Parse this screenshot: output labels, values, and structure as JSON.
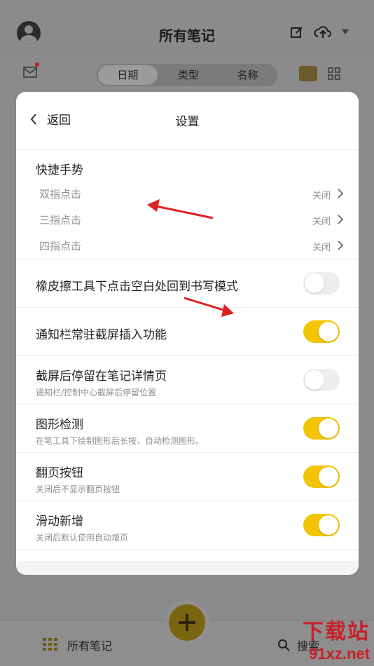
{
  "background": {
    "title": "所有笔记",
    "segments": [
      "日期",
      "类型",
      "名称"
    ],
    "bottom_label": "所有笔记",
    "bottom_search": "搜索"
  },
  "modal": {
    "back_label": "返回",
    "title": "设置",
    "gesture_group": {
      "title": "快捷手势",
      "items": [
        {
          "label": "双指点击",
          "value": "关闭"
        },
        {
          "label": "三指点击",
          "value": "关闭"
        },
        {
          "label": "四指点击",
          "value": "关闭"
        }
      ]
    },
    "settings": [
      {
        "title": "橡皮擦工具下点击空白处回到书写模式",
        "desc": "",
        "on": false
      },
      {
        "title": "通知栏常驻截屏插入功能",
        "desc": "",
        "on": true
      },
      {
        "title": "截屏后停留在笔记详情页",
        "desc": "通知栏/控制中心截屏后停留位置",
        "on": false
      },
      {
        "title": "图形检测",
        "desc": "在笔工具下绘制图形后长按，自动检测图形。",
        "on": true
      },
      {
        "title": "翻页按钮",
        "desc": "关闭后不显示翻页按钮",
        "on": true
      },
      {
        "title": "滑动新增",
        "desc": "关闭后默认使用自动增页",
        "on": true
      }
    ]
  },
  "watermark": {
    "line1": "下载站",
    "line2": "91xz.net"
  },
  "colors": {
    "toggle_on": "#f2c500",
    "toggle_off": "#ededed",
    "annotation_arrow": "#e02020"
  }
}
